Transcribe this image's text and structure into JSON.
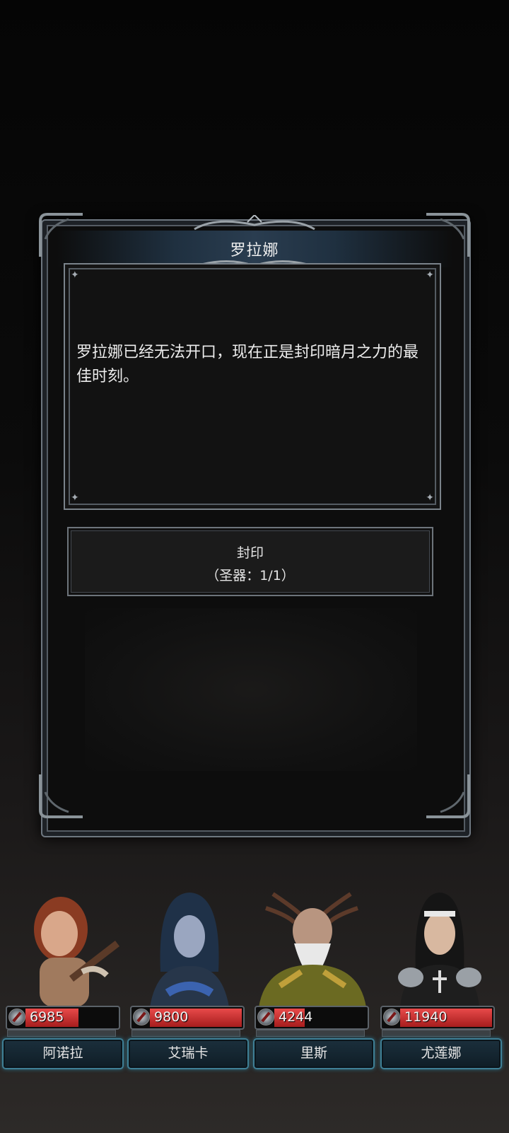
{
  "dialog": {
    "title": "罗拉娜",
    "message": "罗拉娜已经无法开口，现在正是封印暗月之力的最佳时刻。",
    "action": {
      "label": "封印",
      "sublabel": "（圣器：1/1）"
    }
  },
  "party": [
    {
      "name": "阿诺拉",
      "hp": "6985",
      "hp_fill": 0.58
    },
    {
      "name": "艾瑞卡",
      "hp": "9800",
      "hp_fill": 1.0
    },
    {
      "name": "里斯",
      "hp": "4244",
      "hp_fill": 0.33
    },
    {
      "name": "尤莲娜",
      "hp": "11940",
      "hp_fill": 1.0
    }
  ],
  "colors": {
    "hp_red": "#c42a2a",
    "plate_border": "#3f7f95"
  }
}
